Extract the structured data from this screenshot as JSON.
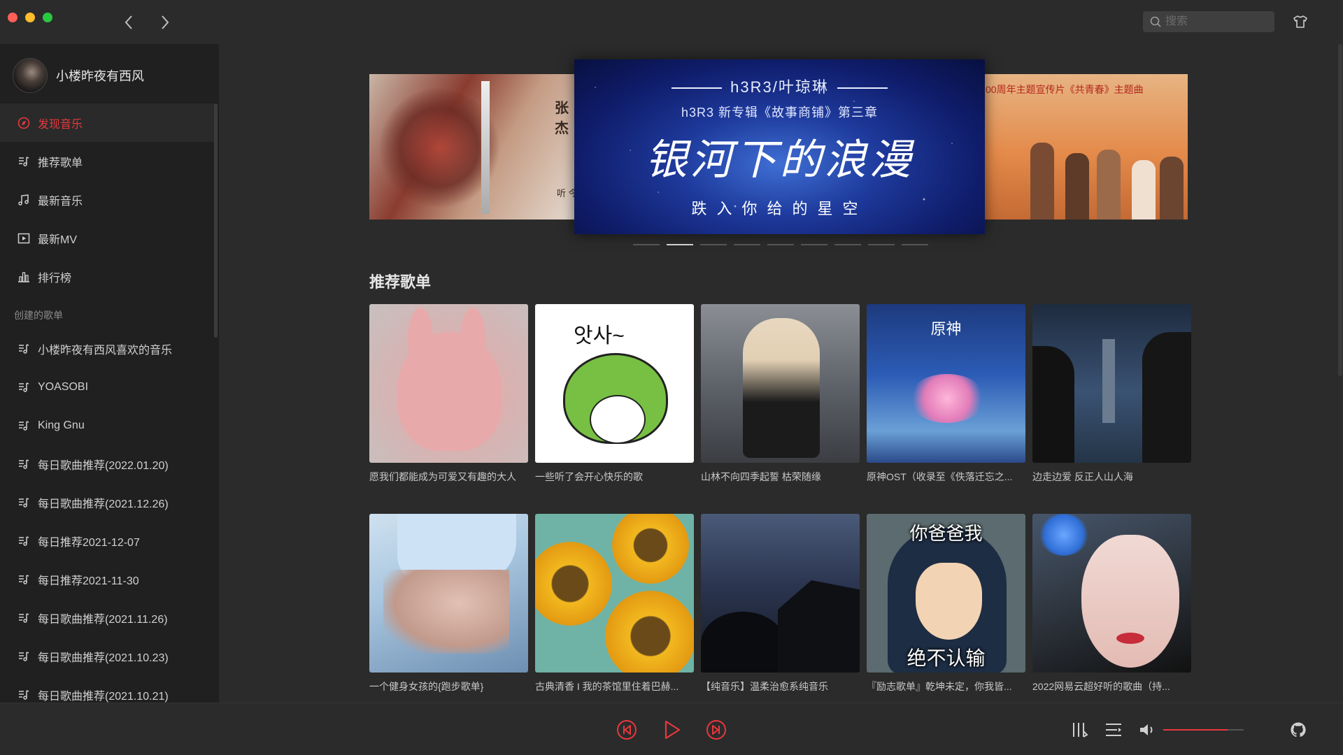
{
  "colors": {
    "accent": "#e8383d",
    "background": "#2b2b2b",
    "sidebar": "#202020"
  },
  "header": {
    "search_placeholder": "搜索",
    "icons": [
      "chevron-left-icon",
      "chevron-right-icon",
      "search-icon",
      "skin-icon"
    ]
  },
  "user": {
    "name": "小楼昨夜有西风"
  },
  "sidebar": {
    "nav": [
      {
        "label": "发现音乐",
        "icon": "discover-icon",
        "active": true
      },
      {
        "label": "推荐歌单",
        "icon": "playlist-icon"
      },
      {
        "label": "最新音乐",
        "icon": "music-note-icon"
      },
      {
        "label": "最新MV",
        "icon": "mv-icon"
      },
      {
        "label": "排行榜",
        "icon": "chart-icon"
      }
    ],
    "section_label": "创建的歌单",
    "playlists": [
      "小楼昨夜有西风喜欢的音乐",
      "YOASOBI",
      "King Gnu",
      "每日歌曲推荐(2022.01.20)",
      "每日歌曲推荐(2021.12.26)",
      "每日推荐2021-12-07",
      "每日推荐2021-11-30",
      "每日歌曲推荐(2021.11.26)",
      "每日歌曲推荐(2021.10.23)",
      "每日歌曲推荐(2021.10.21)"
    ]
  },
  "banner": {
    "left": {
      "text1": "张杰",
      "text2": "听 今"
    },
    "center": {
      "line1": "h3R3/叶琼琳",
      "line2": "h3R3 新专辑《故事商铺》第三章",
      "title": "银河下的浪漫",
      "subtitle": "跌入你给的星空"
    },
    "right": {
      "text1": "00周年主题宣传片《共青春》主题曲"
    },
    "dots_count": 9,
    "active_dot": 1
  },
  "main": {
    "section_title": "推荐歌单",
    "playlists": [
      {
        "title": "愿我们都能成为可爱又有趣的大人"
      },
      {
        "title": "一些听了会开心快乐的歌",
        "cover_text": "앗사~"
      },
      {
        "title": "山林不向四季起誓 枯荣随缘"
      },
      {
        "title": "原神OST（收录至《佚落迁忘之...",
        "cover_text": "原神"
      },
      {
        "title": "边走边爱 反正人山人海"
      },
      {
        "title": "一个健身女孩的{跑步歌单}"
      },
      {
        "title": "古典清香 I 我的茶馆里住着巴赫..."
      },
      {
        "title": "【纯音乐】温柔治愈系纯音乐"
      },
      {
        "title": "『励志歌单』乾坤未定，你我皆...",
        "cover_text": "你爸爸我",
        "cover_text2": "绝不认输"
      },
      {
        "title": "2022网易云超好听的歌曲（持..."
      }
    ]
  },
  "player": {
    "volume": 0.8,
    "icons": [
      "previous-icon",
      "play-icon",
      "next-icon",
      "equalizer-icon",
      "playlist-queue-icon",
      "volume-icon",
      "github-icon"
    ]
  }
}
